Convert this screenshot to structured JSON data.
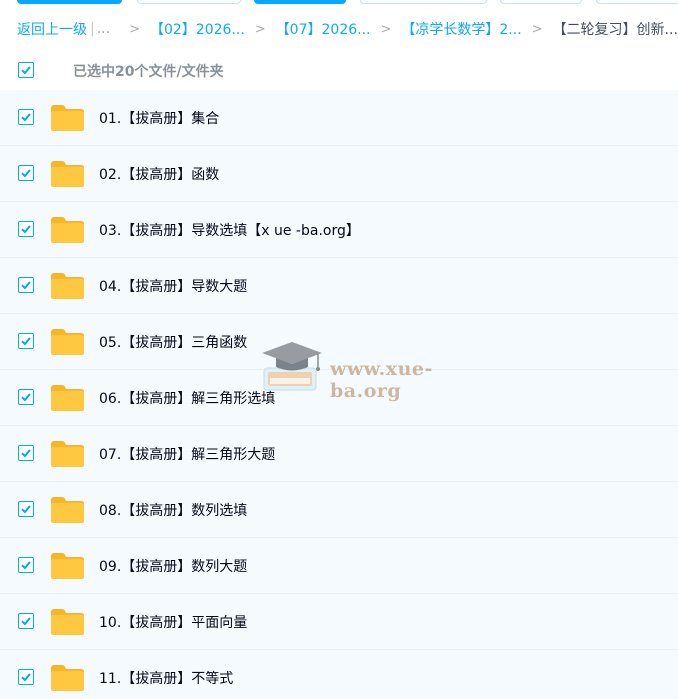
{
  "breadcrumb": {
    "back_label": "返回上一级",
    "ellipsis": "...",
    "items": [
      "【02】2026...",
      "【07】2026...",
      "【凉学长数学】2..."
    ],
    "current": "【二轮复习】创新..."
  },
  "selection": {
    "all_checked": true,
    "count_text": "已选中20个文件/文件夹"
  },
  "files": [
    {
      "name": "01.【拔高册】集合",
      "checked": true
    },
    {
      "name": "02.【拔高册】函数",
      "checked": true
    },
    {
      "name": "03.【拔高册】导数选填【x ue -ba.org】",
      "checked": true
    },
    {
      "name": "04.【拔高册】导数大题",
      "checked": true
    },
    {
      "name": "05.【拔高册】三角函数",
      "checked": true
    },
    {
      "name": "06.【拔高册】解三角形选填",
      "checked": true
    },
    {
      "name": "07.【拔高册】解三角形大题",
      "checked": true
    },
    {
      "name": "08.【拔高册】数列选填",
      "checked": true
    },
    {
      "name": "09.【拔高册】数列大题",
      "checked": true
    },
    {
      "name": "10.【拔高册】平面向量",
      "checked": true
    },
    {
      "name": "11.【拔高册】不等式",
      "checked": true
    }
  ],
  "icons": {
    "folder": "folder-icon",
    "checkbox": "checkmark-icon"
  },
  "colors": {
    "accent": "#06a7ff",
    "link": "#09aaff",
    "folder": "#ffc840",
    "row_bg": "#f5fafe"
  },
  "watermark": {
    "text": "www.xue-ba.org"
  }
}
